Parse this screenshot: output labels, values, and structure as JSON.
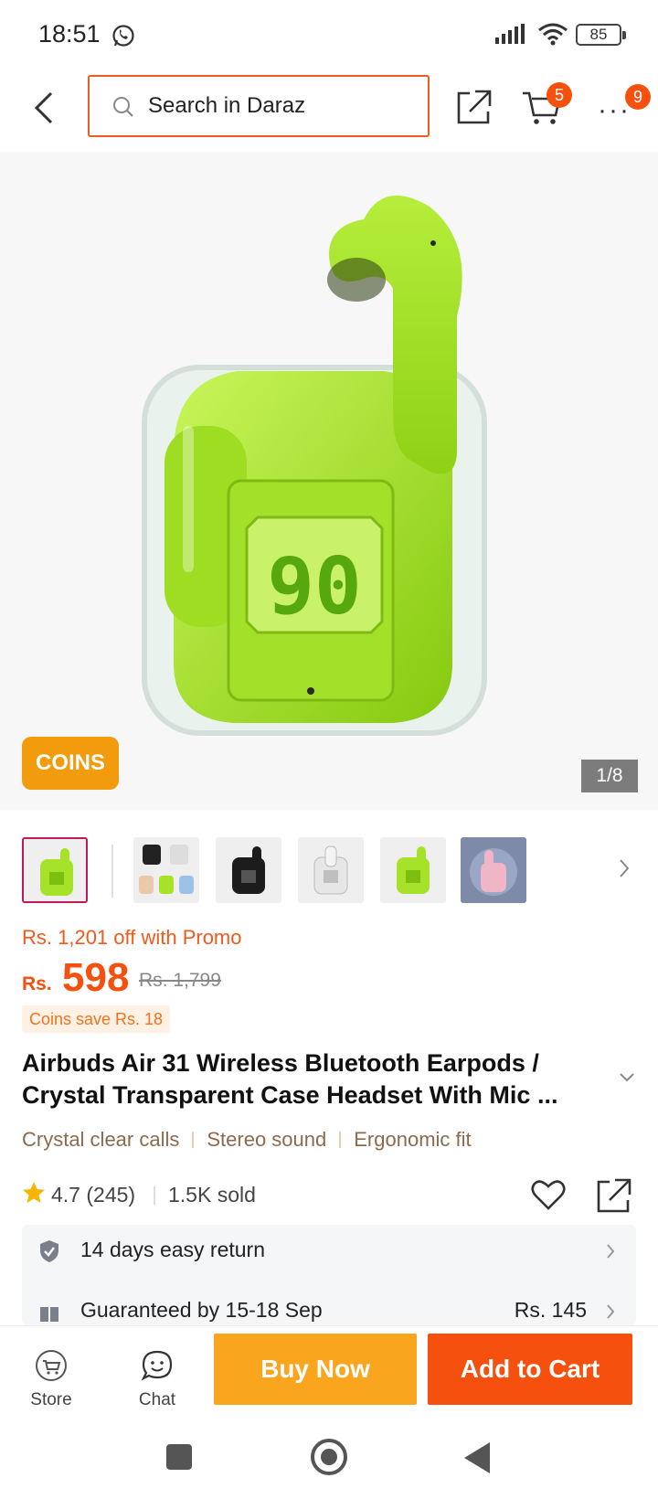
{
  "status_bar": {
    "time": "18:51",
    "battery": "85"
  },
  "header": {
    "search_placeholder": "Search in Daraz",
    "cart_count": "5",
    "more_count": "9"
  },
  "gallery": {
    "coins_tag": "COINS",
    "pager": "1/8",
    "case_display": "90",
    "thumbnail_count": 6
  },
  "price": {
    "promo_text": "Rs. 1,201 off with Promo",
    "currency": "Rs.",
    "current": "598",
    "original": "Rs. 1,799",
    "coins_save": "Coins save Rs. 18"
  },
  "product": {
    "title": "Airbuds Air 31 Wireless Bluetooth Earpods / Crystal Transparent Case Headset With Mic ...",
    "features": [
      "Crystal clear calls",
      "Stereo sound",
      "Ergonomic fit"
    ],
    "rating": "4.7",
    "reviews": "(245)",
    "sold": "1.5K sold"
  },
  "info": {
    "return_label": "14 days easy return",
    "delivery_label": "Guaranteed by 15-18 Sep",
    "delivery_fee": "Rs. 145"
  },
  "actions": {
    "store_label": "Store",
    "chat_label": "Chat",
    "buy_now": "Buy Now",
    "add_to_cart": "Add to Cart"
  },
  "colors": {
    "brand_orange": "#f5500e",
    "buy_now": "#f9a51d",
    "coins_tag": "#f29b0c",
    "product_green": "#a6e22a"
  },
  "icons": [
    "whatsapp-icon",
    "signal-icon",
    "wifi-icon",
    "battery-icon",
    "back-arrow-icon",
    "search-icon",
    "share-icon",
    "cart-icon",
    "more-icon",
    "chevron-right-icon",
    "chevron-down-icon",
    "star-icon",
    "heart-icon",
    "shield-check-icon",
    "gift-icon",
    "store-icon",
    "chat-icon"
  ]
}
